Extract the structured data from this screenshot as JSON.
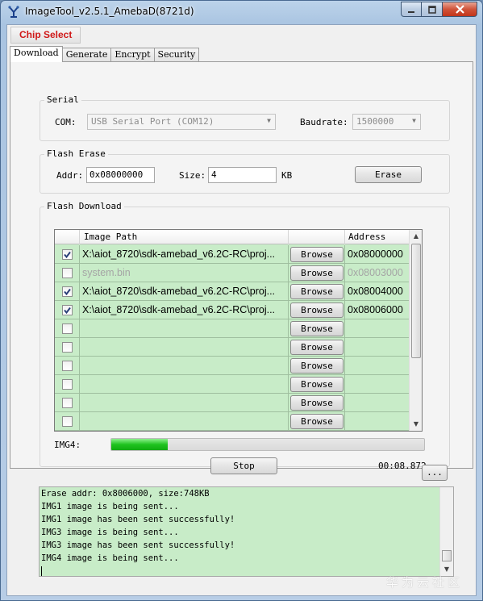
{
  "window": {
    "title": "ImageTool_v2.5.1_AmebaD(8721d)",
    "minimize_icon": "minimize-icon",
    "maximize_icon": "maximize-icon",
    "close_icon": "close-icon"
  },
  "chip_select": {
    "label": "Chip Select",
    "color": "#d01818"
  },
  "tabs": [
    {
      "label": "Download",
      "active": true
    },
    {
      "label": "Generate"
    },
    {
      "label": "Encrypt"
    },
    {
      "label": "Security"
    }
  ],
  "serial": {
    "title": "Serial",
    "com_label": "COM:",
    "com_value": "USB Serial Port (COM12)",
    "baud_label": "Baudrate:",
    "baud_value": "1500000"
  },
  "erase": {
    "title": "Flash Erase",
    "addr_label": "Addr:",
    "addr_value": "0x08000000",
    "size_label": "Size:",
    "size_value": "4",
    "size_unit": "KB",
    "button": "Erase"
  },
  "download": {
    "title": "Flash Download",
    "col_path": "Image Path",
    "col_address": "Address",
    "rows": [
      {
        "checked": true,
        "path": "X:\\aiot_8720\\sdk-amebad_v6.2C-RC\\proj...",
        "browse": "Browse",
        "address": "0x08000000",
        "dim": false
      },
      {
        "checked": false,
        "path": "system.bin",
        "browse": "Browse",
        "address": "0x08003000",
        "dim": true
      },
      {
        "checked": true,
        "path": "X:\\aiot_8720\\sdk-amebad_v6.2C-RC\\proj...",
        "browse": "Browse",
        "address": "0x08004000",
        "dim": false
      },
      {
        "checked": true,
        "path": "X:\\aiot_8720\\sdk-amebad_v6.2C-RC\\proj...",
        "browse": "Browse",
        "address": "0x08006000",
        "dim": false
      },
      {
        "checked": false,
        "path": "",
        "browse": "Browse",
        "address": "",
        "dim": false
      },
      {
        "checked": false,
        "path": "",
        "browse": "Browse",
        "address": "",
        "dim": false
      },
      {
        "checked": false,
        "path": "",
        "browse": "Browse",
        "address": "",
        "dim": false
      },
      {
        "checked": false,
        "path": "",
        "browse": "Browse",
        "address": "",
        "dim": false
      },
      {
        "checked": false,
        "path": "",
        "browse": "Browse",
        "address": "",
        "dim": false
      },
      {
        "checked": false,
        "path": "",
        "browse": "Browse",
        "address": "",
        "dim": false
      }
    ],
    "progress_label": "IMG4:",
    "progress_fraction": 0.18,
    "stop_button": "Stop",
    "elapsed": "00:08.872"
  },
  "more_button": "...",
  "log_lines": [
    "Erase addr: 0x8006000, size:748KB",
    "IMG1 image is being sent...",
    "IMG1 image has been sent successfully!",
    "IMG3 image is being sent...",
    "IMG3 image has been sent successfully!",
    "IMG4 image is being sent..."
  ],
  "watermark": "华为云社区",
  "colors": {
    "grid_bg": "#c8ecc8",
    "progress": "#1fc31f",
    "accent_red": "#d01818"
  }
}
